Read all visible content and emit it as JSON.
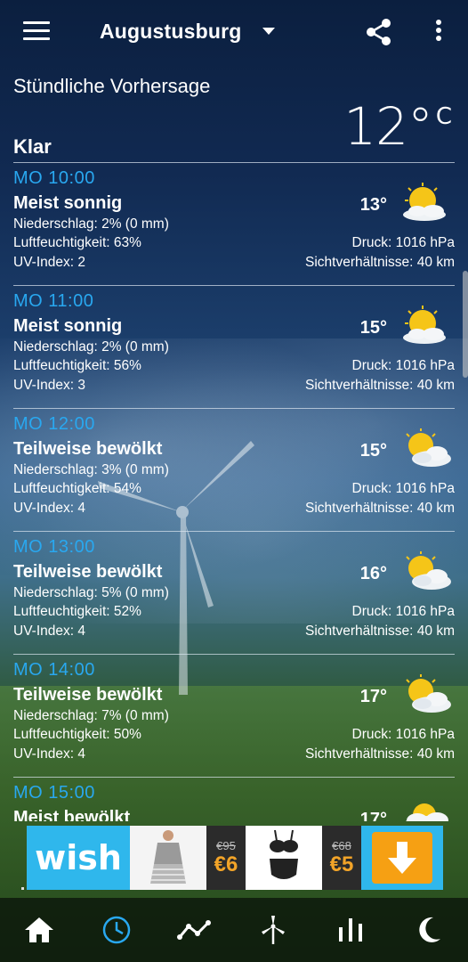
{
  "header": {
    "location": "Augustusburg"
  },
  "section_title": "Stündliche Vorhersage",
  "current": {
    "temperature": "12°",
    "unit": "C",
    "condition": "Klar"
  },
  "hours": [
    {
      "time": "MO  10:00",
      "condition": "Meist sonnig",
      "temp": "13°",
      "precip": "Niederschlag: 2% (0 mm)",
      "humidity": "Luftfeuchtigkeit: 63%",
      "uv": "UV-Index: 2",
      "pressure": "Druck: 1016 hPa",
      "visibility": "Sichtverhältnisse: 40 km",
      "icon": "sun-cloud-icon"
    },
    {
      "time": "MO  11:00",
      "condition": "Meist sonnig",
      "temp": "15°",
      "precip": "Niederschlag: 2% (0 mm)",
      "humidity": "Luftfeuchtigkeit: 56%",
      "uv": "UV-Index: 3",
      "pressure": "Druck: 1016 hPa",
      "visibility": "Sichtverhältnisse: 40 km",
      "icon": "sun-cloud-icon"
    },
    {
      "time": "MO  12:00",
      "condition": "Teilweise bewölkt",
      "temp": "15°",
      "precip": "Niederschlag: 3% (0 mm)",
      "humidity": "Luftfeuchtigkeit: 54%",
      "uv": "UV-Index: 4",
      "pressure": "Druck: 1016 hPa",
      "visibility": "Sichtverhältnisse: 40 km",
      "icon": "partly-cloudy-icon"
    },
    {
      "time": "MO  13:00",
      "condition": "Teilweise bewölkt",
      "temp": "16°",
      "precip": "Niederschlag: 5% (0 mm)",
      "humidity": "Luftfeuchtigkeit: 52%",
      "uv": "UV-Index: 4",
      "pressure": "Druck: 1016 hPa",
      "visibility": "Sichtverhältnisse: 40 km",
      "icon": "partly-cloudy-icon"
    },
    {
      "time": "MO  14:00",
      "condition": "Teilweise bewölkt",
      "temp": "17°",
      "precip": "Niederschlag: 7% (0 mm)",
      "humidity": "Luftfeuchtigkeit: 50%",
      "uv": "UV-Index: 4",
      "pressure": "Druck: 1016 hPa",
      "visibility": "Sichtverhältnisse: 40 km",
      "icon": "partly-cloudy-icon"
    },
    {
      "time": "MO  15:00",
      "condition": "Meist bewölkt",
      "temp": "17°",
      "icon": "mostly-cloudy-icon"
    }
  ],
  "ad": {
    "logo": "wish",
    "price1_old": "€95",
    "price1_new": "€6",
    "price2_old": "€68",
    "price2_new": "€5"
  },
  "bottom_nav": [
    {
      "icon": "home-icon",
      "active": false
    },
    {
      "icon": "clock-icon",
      "active": true
    },
    {
      "icon": "trend-chart-icon",
      "active": false
    },
    {
      "icon": "wind-turbine-icon",
      "active": false
    },
    {
      "icon": "bar-chart-icon",
      "active": false
    },
    {
      "icon": "moon-icon",
      "active": false
    }
  ],
  "colors": {
    "accent": "#29a8f0",
    "sun": "#f5c518",
    "ad_blue": "#2fb7ec",
    "ad_orange": "#f6a013"
  }
}
